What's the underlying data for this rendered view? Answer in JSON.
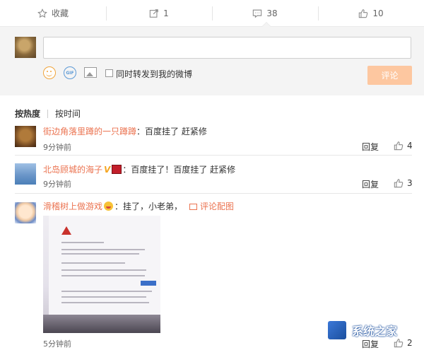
{
  "action_bar": {
    "favorite_label": "收藏",
    "repost_count": "1",
    "comment_count": "38",
    "like_count": "10"
  },
  "compose": {
    "input_value": "",
    "gif_icon_text": "GIF",
    "repost_checkbox_label": "同时转发到我的微博",
    "submit_label": "评论",
    "submit_color": "#fdc7a0"
  },
  "sort_tabs": {
    "by_hot": "按热度",
    "by_time": "按时间"
  },
  "comments": [
    {
      "user": "街边角落里蹲的一只蹲蹲",
      "text": "：百度挂了  赶紧修",
      "time": "9分钟前",
      "reply_label": "回复",
      "likes": "4"
    },
    {
      "user": "北岛顾城的海子",
      "text": "：百度挂了！百度挂了  赶紧修",
      "time": "9分钟前",
      "reply_label": "回复",
      "likes": "3",
      "badge_v": "V"
    },
    {
      "user": "滑稽树上做游戏",
      "text": "：挂了，小老弟，",
      "picture_link": "评论配图",
      "time": "5分钟前",
      "reply_label": "回复",
      "likes": "2"
    }
  ],
  "watermark": {
    "site_name": "系统之家"
  },
  "colors": {
    "username": "#eb7350",
    "compose_bg": "#f4f4f4"
  }
}
